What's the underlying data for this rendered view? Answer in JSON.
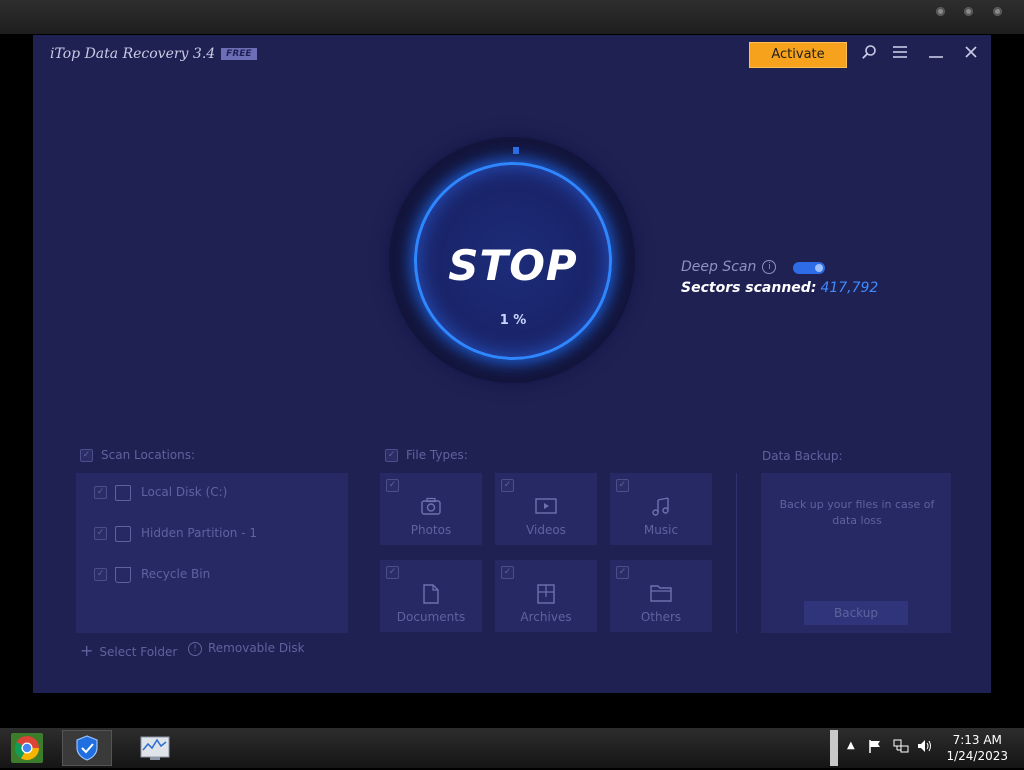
{
  "window": {
    "app_title": "iTop Data Recovery 3.4",
    "badge": "FREE",
    "activate_label": "Activate",
    "search_icon": "🔍",
    "menu_icon": "☰",
    "minimize_icon": "—",
    "close_icon": "✕"
  },
  "scan": {
    "stop_label": "STOP",
    "progress": "1 %",
    "progress_value": 1,
    "deep_scan_label": "Deep Scan",
    "deep_scan_on": true,
    "sectors_label": "Sectors scanned:",
    "sectors_value": "417,792"
  },
  "locations": {
    "heading": "Scan Locations:",
    "items": [
      {
        "label": "Local Disk (C:)"
      },
      {
        "label": "Hidden Partition - 1"
      },
      {
        "label": "Recycle Bin"
      }
    ],
    "select_folder": "Select Folder",
    "removable_disk": "Removable Disk"
  },
  "file_types": {
    "heading": "File Types:",
    "items": [
      {
        "label": "Photos",
        "icon": "camera-icon"
      },
      {
        "label": "Videos",
        "icon": "video-icon"
      },
      {
        "label": "Music",
        "icon": "music-icon"
      },
      {
        "label": "Documents",
        "icon": "document-icon"
      },
      {
        "label": "Archives",
        "icon": "archive-icon"
      },
      {
        "label": "Others",
        "icon": "folder-icon"
      }
    ]
  },
  "backup": {
    "heading": "Data Backup:",
    "text": "Back up your files in case of data loss",
    "button": "Backup"
  },
  "taskbar": {
    "time": "7:13 AM",
    "date": "1/24/2023"
  }
}
